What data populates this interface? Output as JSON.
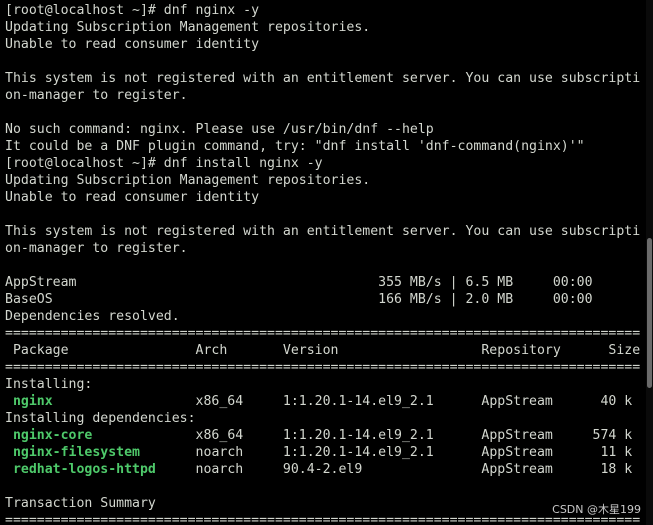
{
  "terminal": {
    "lines": [
      "[root@localhost ~]# dnf nginx -y",
      "Updating Subscription Management repositories.",
      "Unable to read consumer identity",
      "",
      "This system is not registered with an entitlement server. You can use subscripti",
      "on-manager to register.",
      "",
      "No such command: nginx. Please use /usr/bin/dnf --help",
      "It could be a DNF plugin command, try: \"dnf install 'dnf-command(nginx)'\"",
      "[root@localhost ~]# dnf install nginx -y",
      "Updating Subscription Management repositories.",
      "Unable to read consumer identity",
      "",
      "This system is not registered with an entitlement server. You can use subscripti",
      "on-manager to register.",
      "",
      "AppStream                                      355 MB/s | 6.5 MB     00:00",
      "BaseOS                                         166 MB/s | 2.0 MB     00:00",
      "Dependencies resolved.",
      "================================================================================",
      " Package                Arch       Version                  Repository      Size",
      "================================================================================",
      "Installing:"
    ],
    "packages": [
      {
        "pkg": " nginx",
        "rest": "                  x86_64     1:1.20.1-14.el9_2.1      AppStream      40 k"
      },
      {
        "section": "Installing dependencies:"
      },
      {
        "pkg": " nginx-core",
        "rest": "             x86_64     1:1.20.1-14.el9_2.1      AppStream     574 k"
      },
      {
        "pkg": " nginx-filesystem",
        "rest": "       noarch     1:1.20.1-14.el9_2.1      AppStream      11 k"
      },
      {
        "pkg": " redhat-logos-httpd",
        "rest": "     noarch     90.4-2.el9               AppStream      18 k"
      }
    ],
    "tail": [
      "",
      "Transaction Summary",
      "================================================================================"
    ]
  },
  "watermark": "CSDN @木星199",
  "colors": {
    "background": "#000000",
    "text": "#d3d7cf",
    "package_highlight": "#4ec96a"
  }
}
